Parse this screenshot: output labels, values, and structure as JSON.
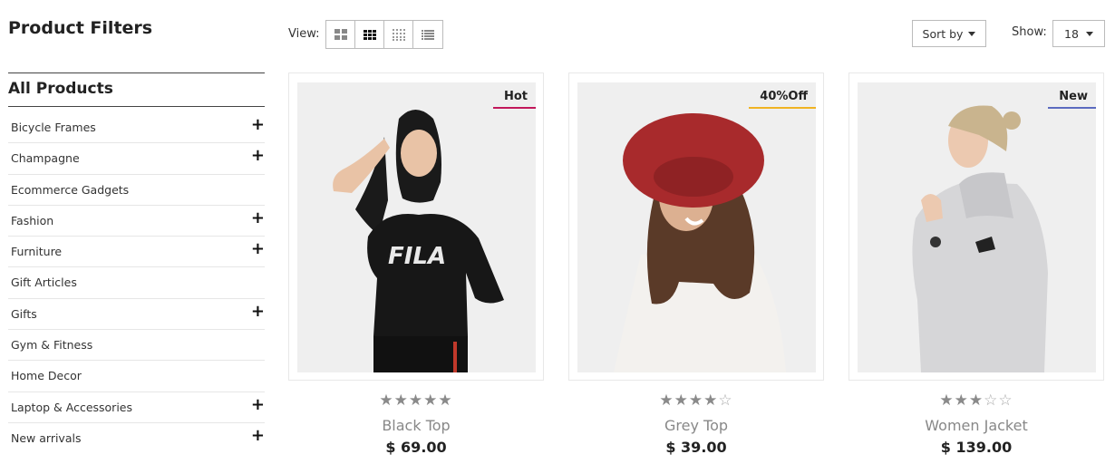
{
  "sidebar": {
    "title": "Product Filters",
    "all_products": "All Products",
    "categories": [
      {
        "label": "Bicycle Frames",
        "expandable": true
      },
      {
        "label": "Champagne",
        "expandable": true
      },
      {
        "label": "Ecommerce Gadgets",
        "expandable": false
      },
      {
        "label": "Fashion",
        "expandable": true
      },
      {
        "label": "Furniture",
        "expandable": true
      },
      {
        "label": "Gift Articles",
        "expandable": false
      },
      {
        "label": "Gifts",
        "expandable": true
      },
      {
        "label": "Gym & Fitness",
        "expandable": false
      },
      {
        "label": "Home Decor",
        "expandable": false
      },
      {
        "label": "Laptop & Accessories",
        "expandable": true
      },
      {
        "label": "New arrivals",
        "expandable": true
      }
    ],
    "expand_icon": "+"
  },
  "toolbar": {
    "view_label": "View:",
    "view_modes": [
      "grid-large-icon",
      "grid-medium-icon",
      "grid-small-icon",
      "list-icon"
    ],
    "active_view": 1,
    "sort_label": "Sort by",
    "show_label": "Show:",
    "show_value": "18"
  },
  "products": [
    {
      "name": "Black Top",
      "price": "$ 69.00",
      "rating": 5,
      "badge": "Hot",
      "badge_color": "#c2185b"
    },
    {
      "name": "Grey Top",
      "price": "$ 39.00",
      "rating": 4,
      "badge": "40%Off",
      "badge_color": "#f0b323"
    },
    {
      "name": "Women Jacket",
      "price": "$ 139.00",
      "rating": 3,
      "badge": "New",
      "badge_color": "#5c6bc0"
    }
  ]
}
